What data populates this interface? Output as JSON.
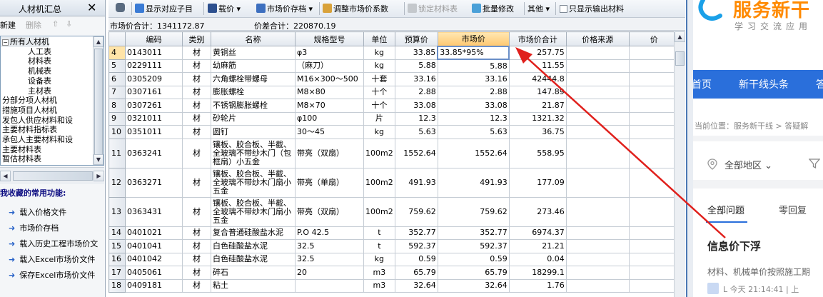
{
  "left_panel": {
    "title": "人材机汇总",
    "close_glyph": "✕",
    "tools": {
      "new": "新建",
      "delete": "删除",
      "up": "⇧",
      "down": "⇩"
    },
    "tree": [
      {
        "label": "所有人材机",
        "level": 0,
        "expanded": true,
        "selected": true
      },
      {
        "label": "人工表",
        "level": 1
      },
      {
        "label": "材料表",
        "level": 1
      },
      {
        "label": "机械表",
        "level": 1
      },
      {
        "label": "设备表",
        "level": 1
      },
      {
        "label": "主材表",
        "level": 1
      },
      {
        "label": "分部分项人材机",
        "level": 0
      },
      {
        "label": "措施项目人材机",
        "level": 0
      },
      {
        "label": "发包人供应材料和设",
        "level": 0
      },
      {
        "label": "主要材料指标表",
        "level": 0
      },
      {
        "label": "承包人主要材料和设",
        "level": 0
      },
      {
        "label": "主要材料表",
        "level": 0
      },
      {
        "label": "暂估材料表",
        "level": 0
      }
    ],
    "favorites_title": "我收藏的常用功能:",
    "favorites": [
      "载入价格文件",
      "市场价存档",
      "载入历史工程市场价文",
      "载入Excel市场价文件",
      "保存Excel市场价文件"
    ]
  },
  "toolbar": {
    "items": [
      {
        "label": "",
        "icon": "binoculars-icon",
        "enabled": true
      },
      {
        "label": "显示对应子目",
        "icon": "show-subitem-icon",
        "enabled": true
      },
      {
        "label": "载价 ▾",
        "icon": "load-price-icon",
        "enabled": true
      },
      {
        "label": "市场价存档 ▾",
        "icon": "archive-icon",
        "enabled": true
      },
      {
        "label": "调整市场价系数",
        "icon": "adjust-coef-icon",
        "enabled": true
      },
      {
        "label": "锁定材料表",
        "icon": "lock-icon",
        "enabled": false
      },
      {
        "label": "批量修改",
        "icon": "batch-edit-icon",
        "enabled": true
      },
      {
        "label": "其他 ▾",
        "icon": "",
        "enabled": true
      },
      {
        "label": "只显示输出材料",
        "icon": "checkbox-icon",
        "enabled": true
      }
    ]
  },
  "summary": {
    "market_total": "市场价合计：1341172.87",
    "price_diff_total": "价差合计：220870.19"
  },
  "grid": {
    "columns": [
      "",
      "编码",
      "类别",
      "名称",
      "规格型号",
      "单位",
      "预算价",
      "市场价",
      "市场价合计",
      "价格来源",
      "价"
    ],
    "highlight_column": 7,
    "current_row": "4",
    "editing_value": "33.85*95%",
    "rows": [
      [
        "4",
        "0143011",
        "材",
        "黄铜丝",
        "φ3",
        "kg",
        "33.85",
        "33.85*95%",
        "257.75",
        ""
      ],
      [
        "5",
        "0229111",
        "材",
        "幼麻筋",
        "（麻刀）",
        "kg",
        "5.88",
        "5.88",
        "11.55",
        ""
      ],
      [
        "6",
        "0305209",
        "材",
        "六角螺栓带螺母",
        "M16×300～500",
        "十套",
        "33.16",
        "33.16",
        "42444.8",
        ""
      ],
      [
        "7",
        "0307161",
        "材",
        "膨胀螺栓",
        "M8×80",
        "十个",
        "2.88",
        "2.88",
        "147.89",
        ""
      ],
      [
        "8",
        "0307261",
        "材",
        "不锈钢膨胀螺栓",
        "M8×70",
        "十个",
        "33.08",
        "33.08",
        "21.87",
        ""
      ],
      [
        "9",
        "0321011",
        "材",
        "砂轮片",
        "φ100",
        "片",
        "12.3",
        "12.3",
        "1321.32",
        ""
      ],
      [
        "10",
        "0351011",
        "材",
        "圆钉",
        "30～45",
        "kg",
        "5.63",
        "5.63",
        "36.75",
        ""
      ],
      [
        "11",
        "0363241",
        "材",
        "镶板、胶合板、半截、全玻璃不带纱木门（包框扇）小五金",
        "带亮（双扇）",
        "100m2",
        "1552.64",
        "1552.64",
        "558.95",
        ""
      ],
      [
        "12",
        "0363271",
        "材",
        "镶板、胶合板、半截、全玻璃不带纱木门扇小五金",
        "带亮（单扇）",
        "100m2",
        "491.93",
        "491.93",
        "177.09",
        ""
      ],
      [
        "13",
        "0363431",
        "材",
        "镶板、胶合板、半截、全玻璃不带纱木门扇小五金",
        "带亮（双扇）",
        "100m2",
        "759.62",
        "759.62",
        "273.46",
        ""
      ],
      [
        "14",
        "0401021",
        "材",
        "复合普通硅酸盐水泥",
        "P.O 42.5",
        "t",
        "352.77",
        "352.77",
        "6974.37",
        ""
      ],
      [
        "15",
        "0401041",
        "材",
        "白色硅酸盐水泥",
        "32.5",
        "t",
        "592.37",
        "592.37",
        "21.21",
        ""
      ],
      [
        "16",
        "0401042",
        "材",
        "白色硅酸盐水泥",
        "32.5",
        "kg",
        "0.59",
        "0.59",
        "0.04",
        ""
      ],
      [
        "17",
        "0405061",
        "材",
        "碎石",
        "20",
        "m3",
        "65.79",
        "65.79",
        "18299.1",
        ""
      ],
      [
        "18",
        "0409181",
        "材",
        "粘土",
        "",
        "m3",
        "32.64",
        "32.64",
        "1.76",
        ""
      ]
    ]
  },
  "right_panel": {
    "brand": "服务新干",
    "slogan": "学习交流应用",
    "nav": [
      "首页",
      "新干线头条",
      "答"
    ],
    "breadcrumb": "当前位置：服务新干线 > 答疑解",
    "region": "全部地区 ⌄",
    "tabs": [
      "全部问题",
      "零回复"
    ],
    "question_title": "信息价下浮",
    "question_desc": "材料、机械单价按照施工期",
    "question_meta": "L 今天 21:14:41  |  上",
    "accent": "#2a6fdb",
    "brand_color": "#ff8a00"
  },
  "annotation": {
    "arrow_color": "#e0201c"
  }
}
